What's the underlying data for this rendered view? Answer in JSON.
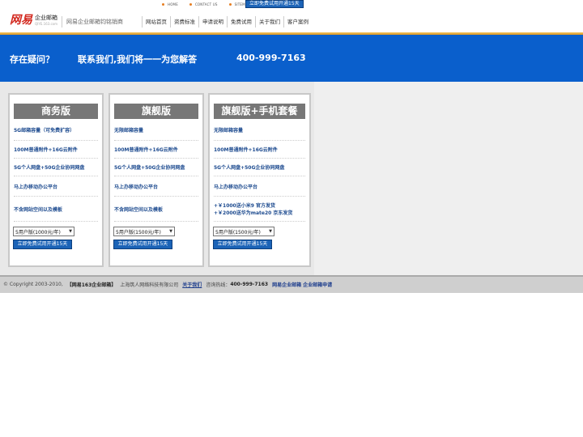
{
  "toplinks": [
    "HOME",
    "CONTACT US",
    "SITEMAP"
  ],
  "top_trial_button": "立即免费试用开通15天",
  "logo": {
    "brand": "网易",
    "product": "企业邮箱",
    "domain": "QIYE.163.com"
  },
  "tagline": "网易企业邮箱钧铭销商",
  "nav": [
    "网站首页",
    "资费标准",
    "申请说明",
    "免费试用",
    "关于我们",
    "客户案例"
  ],
  "banner": {
    "question": "存在疑问？",
    "message": "联系我们,我们将一一为您解答",
    "phone": "400-999-7163"
  },
  "plans": [
    {
      "title": "商务版",
      "features": [
        "5G邮箱容量（可免费扩容）",
        "100M普通附件+16G云附件",
        "5G个人网盘+50G企业协同网盘",
        "马上办移动办公平台",
        "不含网站空间以及模板"
      ],
      "select": "5用户版(1000元/年)",
      "trial": "立即免费试用开通15天"
    },
    {
      "title": "旗舰版",
      "features": [
        "无限邮箱容量",
        "100M普通附件+16G云附件",
        "5G个人网盘+50G企业协同网盘",
        "马上办移动办公平台",
        "不含网站空间以及模板"
      ],
      "select": "5用户版(1500元/年)",
      "trial": "立即免费试用开通15天"
    },
    {
      "title": "旗舰版+手机套餐",
      "features": [
        "无限邮箱容量",
        "100M普通附件+16G云附件",
        "5G个人网盘+50G企业协同网盘",
        "马上办移动办公平台"
      ],
      "gifts": [
        "+￥1000送小米9 官方发货",
        "+￥2000送华为mate20 京东发货"
      ],
      "select": "5用户版(1500元/年)",
      "trial": "立即免费试用开通15天"
    }
  ],
  "footer": {
    "copyright": "© Copyright 2003-2010,",
    "brand": "【网易163企业邮箱】",
    "company": "上海筑人网络科技有限公司",
    "about_link": "关于我们",
    "hotline_label": "咨询热线：",
    "hotline": "400-999-7163",
    "tail": "网易企业邮箱 企业邮箱申请"
  },
  "colors": {
    "banner": "#0a5fcc",
    "accent_red": "#d2261c",
    "button_blue": "#1b63b7",
    "feature_text": "#1c4a8f"
  }
}
